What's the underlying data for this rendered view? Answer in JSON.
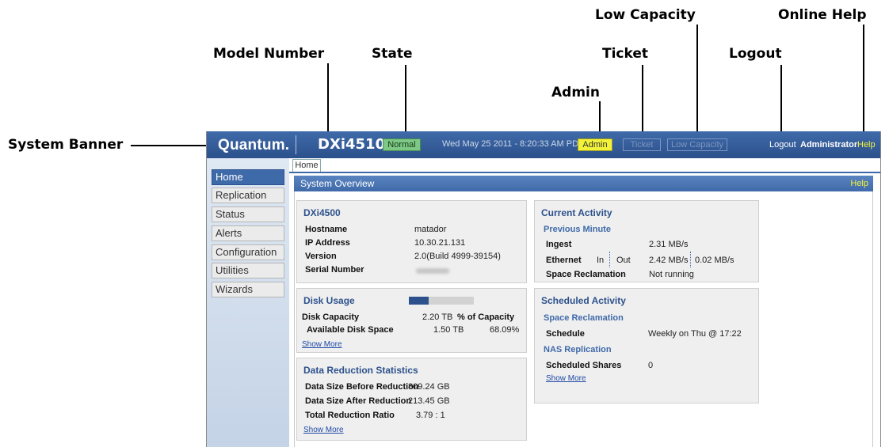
{
  "callouts": {
    "system_banner": "System Banner",
    "model_number": "Model Number",
    "state": "State",
    "admin": "Admin",
    "ticket": "Ticket",
    "low_capacity": "Low Capacity",
    "logout": "Logout",
    "online_help": "Online Help"
  },
  "banner": {
    "logo": "Quantum.",
    "model": "DXi4510",
    "state": "Normal",
    "datetime": "Wed May 25 2011 - 8:20:33 AM PDT",
    "admin_label": "Admin",
    "ticket_label": "Ticket",
    "low_capacity_label": "Low Capacity",
    "logout_label": "Logout",
    "user": "Administrator",
    "help_label": "Help",
    "colors": {
      "banner": "#3f6aa9",
      "state_ok": "#7cc884",
      "admin": "#f2f23a"
    }
  },
  "nav": {
    "items": [
      {
        "label": "Home",
        "active": true
      },
      {
        "label": "Replication",
        "active": false
      },
      {
        "label": "Status",
        "active": false
      },
      {
        "label": "Alerts",
        "active": false
      },
      {
        "label": "Configuration",
        "active": false
      },
      {
        "label": "Utilities",
        "active": false
      },
      {
        "label": "Wizards",
        "active": false
      }
    ]
  },
  "tabs": [
    "Home"
  ],
  "page": {
    "title": "System Overview",
    "help": "Help"
  },
  "system": {
    "title": "DXi4500",
    "rows": [
      {
        "label": "Hostname",
        "value": "matador"
      },
      {
        "label": "IP Address",
        "value": "10.30.21.131"
      },
      {
        "label": "Version",
        "value": "2.0(Build 4999-39154)"
      },
      {
        "label": "Serial Number",
        "value": ""
      }
    ]
  },
  "disk": {
    "title": "Disk Usage",
    "used_fraction": 0.31,
    "capacity_label": "Disk Capacity",
    "capacity_value": "2.20 TB",
    "pct_header": "% of Capacity",
    "available_label": "Available Disk Space",
    "available_value": "1.50 TB",
    "available_pct": "68.09%",
    "show_more": "Show More"
  },
  "reduction": {
    "title": "Data Reduction Statistics",
    "rows": [
      {
        "label": "Data Size Before Reduction",
        "value": "809.24 GB"
      },
      {
        "label": "Data Size After Reduction",
        "value": "213.45 GB"
      },
      {
        "label": "Total Reduction Ratio",
        "value": "3.79 : 1"
      }
    ],
    "show_more": "Show More"
  },
  "current": {
    "title": "Current Activity",
    "subtitle": "Previous Minute",
    "ingest_label": "Ingest",
    "ingest_value": "2.31 MB/s",
    "ethernet_label": "Ethernet",
    "in_label": "In",
    "out_label": "Out",
    "eth_in": "2.42 MB/s",
    "eth_out": "0.02 MB/s",
    "space_label": "Space Reclamation",
    "space_value": "Not running"
  },
  "scheduled": {
    "title": "Scheduled Activity",
    "space_sub": "Space Reclamation",
    "schedule_label": "Schedule",
    "schedule_value": "Weekly on Thu @ 17:22",
    "nas_sub": "NAS Replication",
    "shares_label": "Scheduled Shares",
    "shares_value": "0",
    "show_more": "Show More"
  }
}
